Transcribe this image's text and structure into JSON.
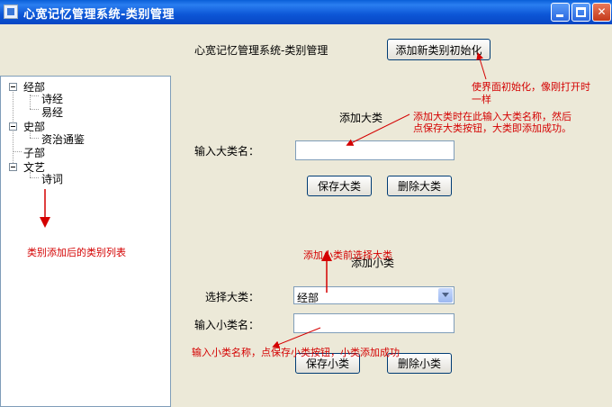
{
  "window": {
    "title": "心宽记忆管理系统-类别管理"
  },
  "header": {
    "label": "心宽记忆管理系统-类别管理",
    "init_button": "添加新类别初始化"
  },
  "tree": {
    "nodes": [
      {
        "label": "经部",
        "children": [
          "诗经",
          "易经"
        ]
      },
      {
        "label": "史部",
        "children": [
          "资治通鉴"
        ]
      },
      {
        "label": "子部",
        "children": []
      },
      {
        "label": "文艺",
        "children": [
          "诗词"
        ]
      }
    ]
  },
  "major": {
    "section_title": "添加大类",
    "input_label": "输入大类名：",
    "input_value": "",
    "save_button": "保存大类",
    "delete_button": "删除大类"
  },
  "minor": {
    "section_title": "添加小类",
    "select_label": "选择大类：",
    "select_value": "经部",
    "input_label": "输入小类名：",
    "input_value": "",
    "save_button": "保存小类",
    "delete_button": "删除小类"
  },
  "annotations": {
    "init_line1": "使界面初始化，像刚打开时",
    "init_line2": "一样",
    "major_line1": "添加大类时在此输入大类名称，然后",
    "major_line2": "点保存大类按钮，大类即添加成功。",
    "tree_note": "类别添加后的类别列表",
    "minor_select_note": "添加小类前选择大类",
    "minor_input_note": "输入小类名称，点保存小类按钮，小类添加成功"
  },
  "colors": {
    "annotation": "#d40000",
    "titlebar": "#0a5fd8"
  }
}
